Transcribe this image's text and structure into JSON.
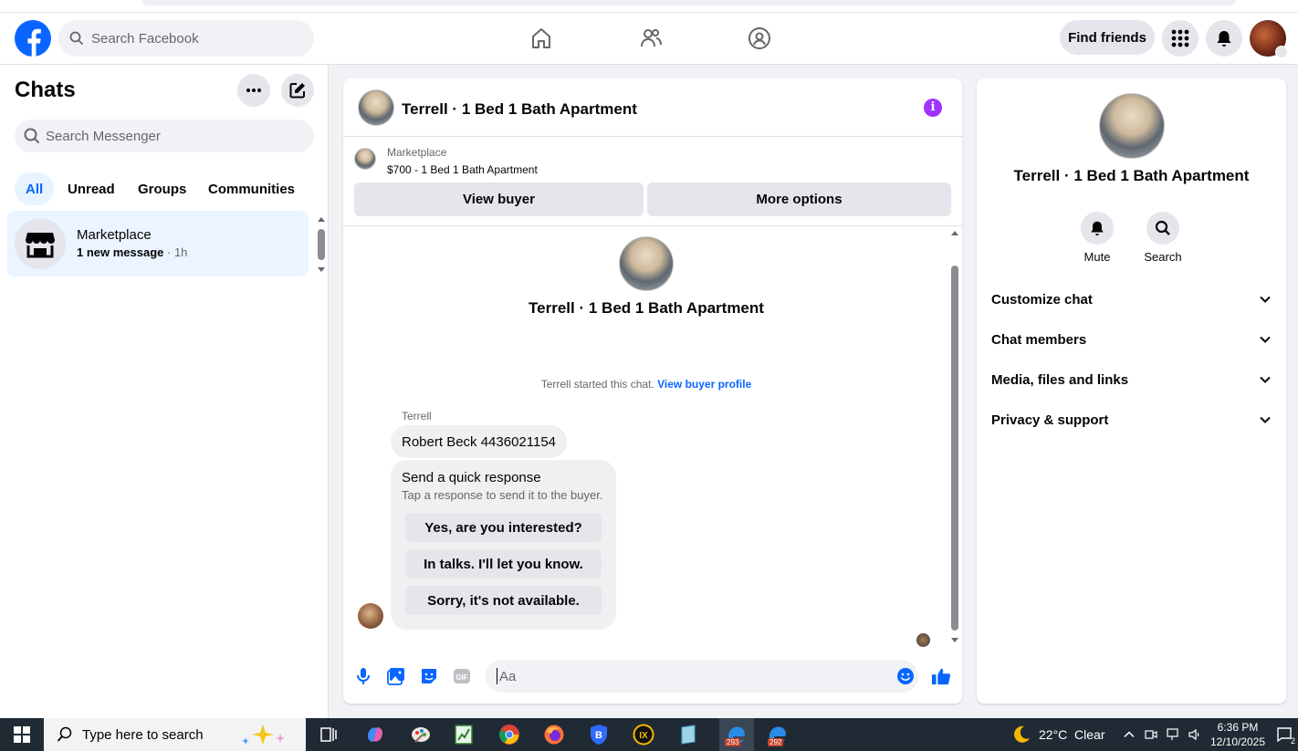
{
  "header": {
    "search_placeholder": "Search Facebook",
    "find_friends": "Find friends"
  },
  "sidebar": {
    "title": "Chats",
    "search_placeholder": "Search Messenger",
    "tabs": [
      {
        "label": "All",
        "active": true
      },
      {
        "label": "Unread",
        "active": false
      },
      {
        "label": "Groups",
        "active": false
      },
      {
        "label": "Communities",
        "active": false
      }
    ],
    "chats": [
      {
        "name": "Marketplace",
        "preview": "1 new message",
        "time": "· 1h"
      }
    ]
  },
  "conversation": {
    "title": "Terrell · 1 Bed 1 Bath Apartment",
    "banner": {
      "label": "Marketplace",
      "listing": "$700 - 1 Bed 1 Bath Apartment",
      "view_buyer": "View buyer",
      "more_options": "More options"
    },
    "thread_title": "Terrell · 1 Bed 1 Bath Apartment",
    "started_text": "Terrell started this chat.",
    "started_link": "View buyer profile",
    "sender": "Terrell",
    "message": "Robert Beck 4436021154",
    "quick": {
      "title": "Send a quick response",
      "subtitle": "Tap a response to send it to the buyer.",
      "options": [
        "Yes, are you interested?",
        "In talks. I'll let you know.",
        "Sorry, it's not available."
      ]
    },
    "input_placeholder": "Aa"
  },
  "details": {
    "title": "Terrell · 1 Bed 1 Bath Apartment",
    "actions": [
      {
        "label": "Mute"
      },
      {
        "label": "Search"
      }
    ],
    "sections": [
      "Customize chat",
      "Chat members",
      "Media, files and links",
      "Privacy & support"
    ]
  },
  "taskbar": {
    "search_placeholder": "Type here to search",
    "badge_1": "293",
    "badge_2": "292",
    "weather": "22°C  Clear",
    "time": "6:36 PM",
    "date": "12/10/2025",
    "notification_count": "2"
  },
  "colors": {
    "brand": "#0866ff",
    "info": "#a033ff",
    "taskbar": "#202a35"
  }
}
